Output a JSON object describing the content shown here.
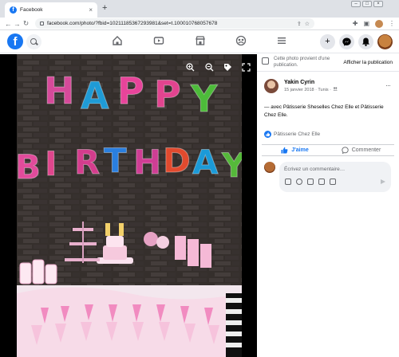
{
  "browser": {
    "tab_title": "Facebook",
    "tab_close": "×",
    "new_tab": "+",
    "url": "facebook.com/photo/?fbid=10211185367293981&set=t.100010768057678",
    "win_min": "–",
    "win_max": "□",
    "win_close": "×"
  },
  "header": {
    "logo": "f",
    "create": "+"
  },
  "panel": {
    "notice_text": "Cette photo provient d'une publication.",
    "notice_button": "Afficher la publication",
    "author_name": "Yakin Cyrin",
    "author_meta": "15 janvier 2018 · Tunis · ",
    "more": "···",
    "caption": "— avec Pâtisserie Sheselles Chez Elle et Pâtisserie Chez Elle.",
    "reaction_text": "Pâtisserie Chez Elle",
    "like_label": "J'aime",
    "comment_label": "Commenter",
    "comment_placeholder": "Écrivez un commentaire…"
  },
  "photo": {
    "banner_top": [
      "H",
      "A",
      "P",
      "P",
      "Y"
    ],
    "banner_top_colors": [
      "#d64a9a",
      "#1f9bd6",
      "#e8449a",
      "#e2448f",
      "#4dbb3a"
    ],
    "banner_bottom": [
      "B",
      "I",
      "R",
      "T",
      "H",
      "D",
      "A",
      "Y"
    ],
    "banner_bottom_colors": [
      "#e14b9b",
      "#e0468d",
      "#d43d8d",
      "#2a7fe0",
      "#cf3e94",
      "#e24a2e",
      "#1b9ad8",
      "#55b93a"
    ]
  },
  "colors": {
    "fb_blue": "#1877f2",
    "secondary_text": "#65676b"
  }
}
